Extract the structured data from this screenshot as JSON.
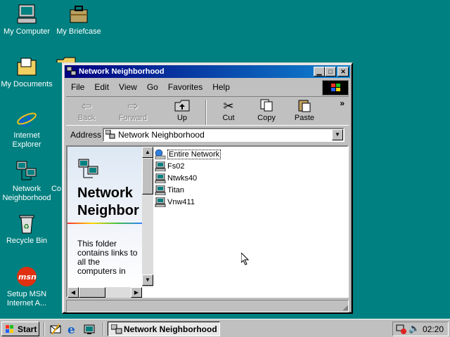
{
  "desktop": {
    "icons": [
      {
        "label": "My Computer",
        "icon": "my-computer-icon"
      },
      {
        "label": "My Briefcase",
        "icon": "briefcase-icon"
      },
      {
        "label": "My Documents",
        "icon": "documents-folder-icon"
      },
      {
        "label": "Internet Explorer",
        "icon": "internet-explorer-icon"
      },
      {
        "label": "Network Neighborhood",
        "icon": "network-neighborhood-icon"
      },
      {
        "label": "Recycle Bin",
        "icon": "recycle-bin-icon"
      },
      {
        "label": "Setup MSN Internet A...",
        "icon": "msn-icon"
      },
      {
        "label": "Co",
        "icon": "partial-icon"
      }
    ]
  },
  "window": {
    "title": "Network Neighborhood",
    "menu": [
      "File",
      "Edit",
      "View",
      "Go",
      "Favorites",
      "Help"
    ],
    "toolbar": {
      "back": "Back",
      "forward": "Forward",
      "up": "Up",
      "cut": "Cut",
      "copy": "Copy",
      "paste": "Paste",
      "more": "»"
    },
    "address_label": "Address",
    "address_value": "Network Neighborhood",
    "left_pane": {
      "title_line1": "Network",
      "title_line2": "Neighbor",
      "description": "This folder contains links to all the computers in"
    },
    "files": [
      {
        "name": "Entire Network",
        "icon": "globe-network-icon",
        "selected": true
      },
      {
        "name": "Fs02",
        "icon": "computer-icon",
        "selected": false
      },
      {
        "name": "Ntwks40",
        "icon": "computer-icon",
        "selected": false
      },
      {
        "name": "Titan",
        "icon": "computer-icon",
        "selected": false
      },
      {
        "name": "Vnw411",
        "icon": "computer-icon",
        "selected": false
      }
    ]
  },
  "taskbar": {
    "start_label": "Start",
    "task_label": "Network Neighborhood",
    "clock": "02:20"
  },
  "colors": {
    "desktop": "#008080",
    "titlebar_start": "#000080",
    "titlebar_end": "#1084d0",
    "face": "#c0c0c0"
  }
}
